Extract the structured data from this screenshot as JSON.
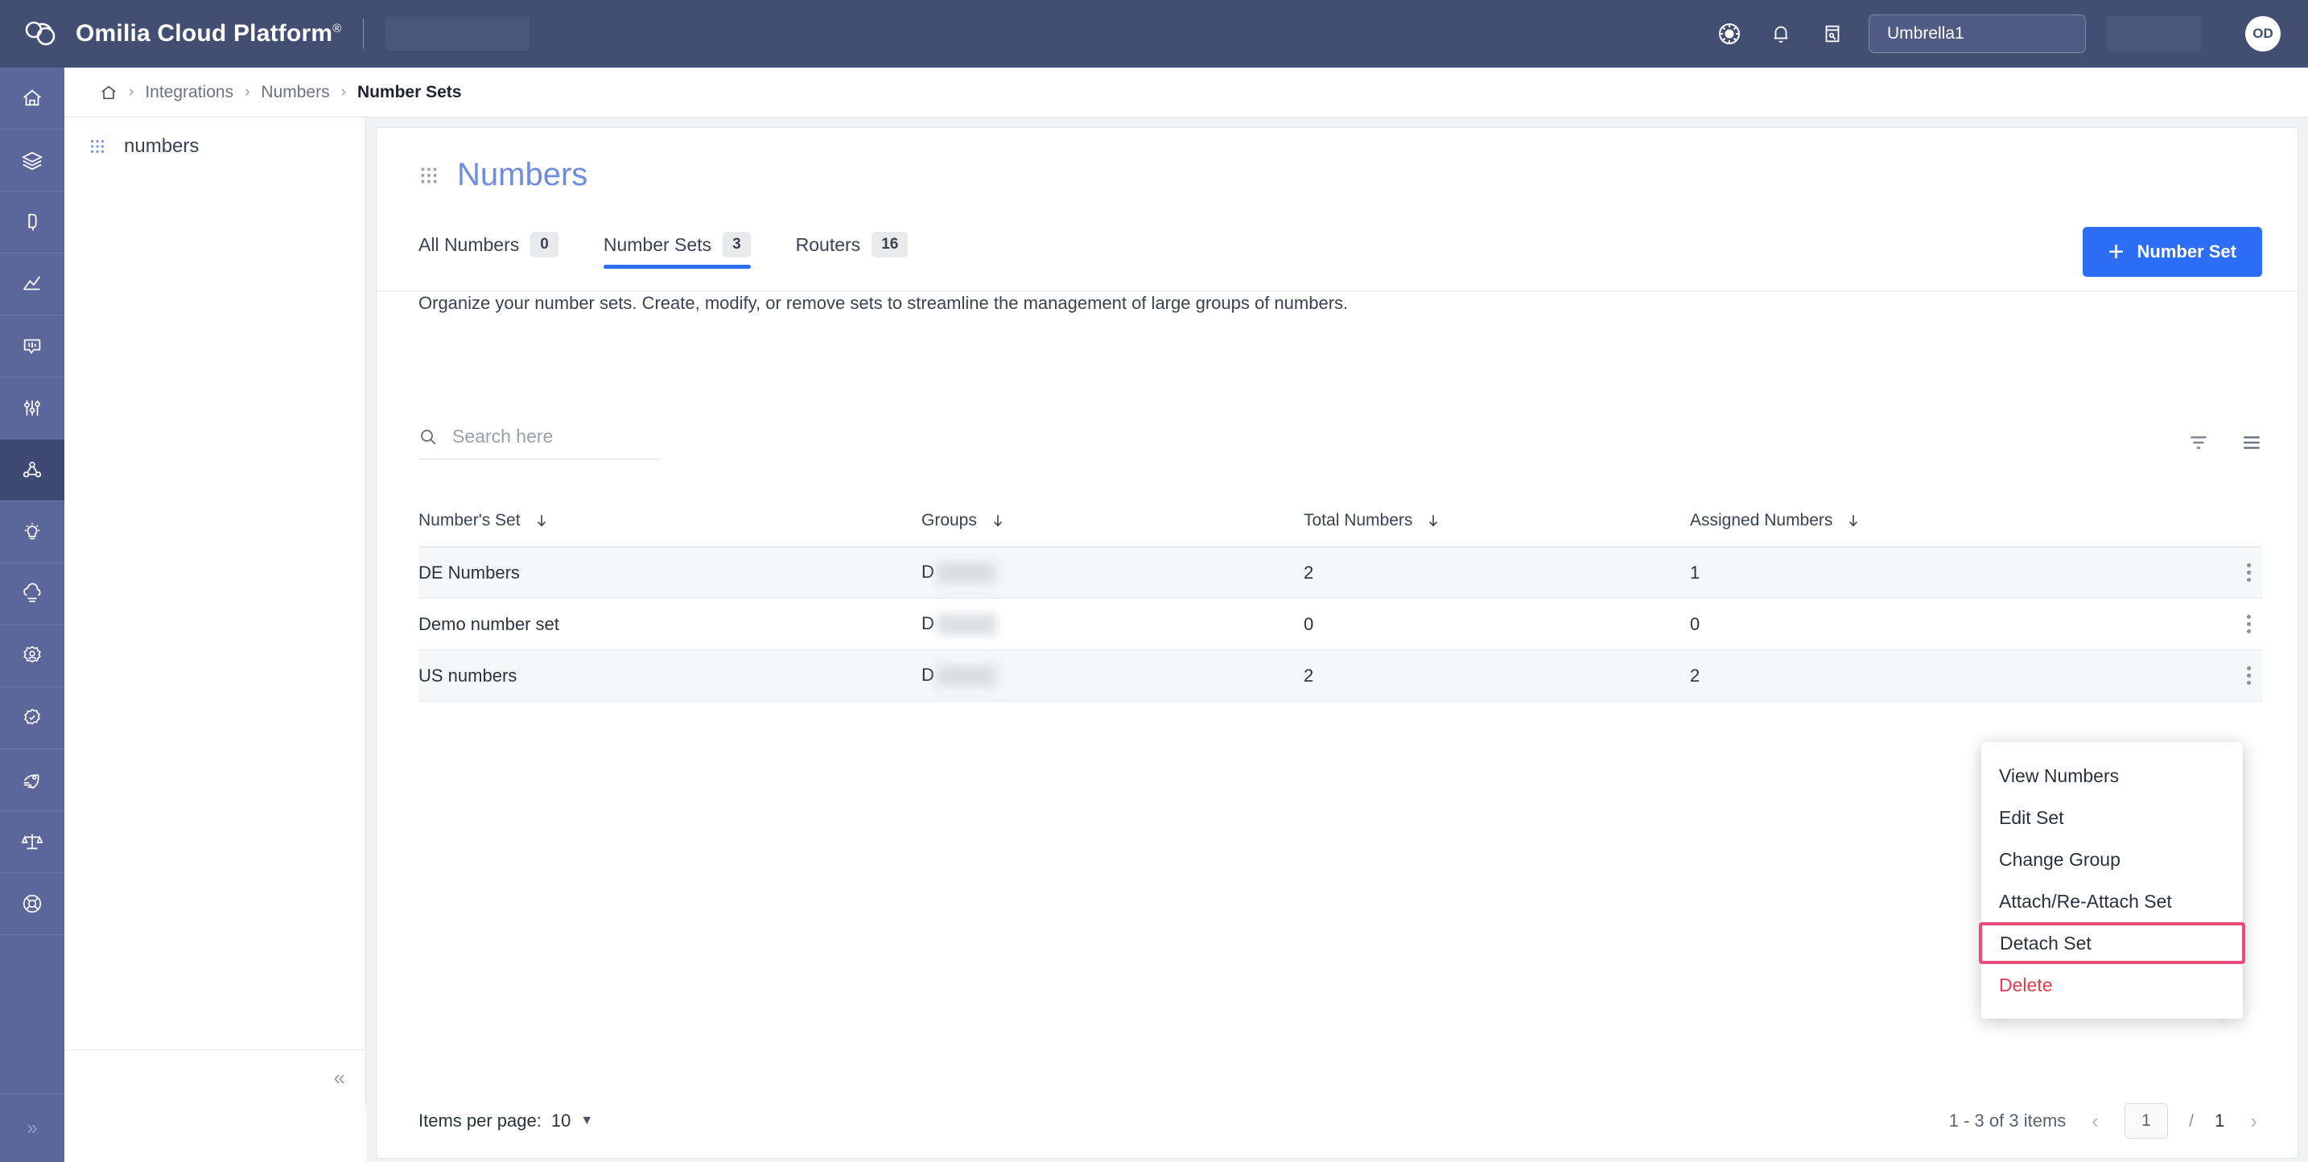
{
  "header": {
    "brand": "Omilia Cloud Platform",
    "brand_mark": "®",
    "logo_icon": "omilia-cloud-logo",
    "icons": [
      "accessibility-icon",
      "bell-icon",
      "note-edit-icon"
    ],
    "tenant": "Umbrella1",
    "avatar_initials": "OD"
  },
  "rail": {
    "items": [
      {
        "name": "home",
        "icon": "home-icon"
      },
      {
        "name": "layers",
        "icon": "layers-icon"
      },
      {
        "name": "voice",
        "icon": "microphone-icon"
      },
      {
        "name": "analytics",
        "icon": "analytics-chart-icon"
      },
      {
        "name": "conversations",
        "icon": "chat-bars-icon"
      },
      {
        "name": "tuning",
        "icon": "sliders-icon"
      },
      {
        "name": "integrations",
        "icon": "nodes-network-icon"
      },
      {
        "name": "insights",
        "icon": "lightbulb-icon"
      },
      {
        "name": "cloud",
        "icon": "cloud-lines-icon"
      },
      {
        "name": "accounts",
        "icon": "user-gear-icon"
      },
      {
        "name": "quality",
        "icon": "badge-check-icon"
      },
      {
        "name": "deployments",
        "icon": "rocket-icon"
      },
      {
        "name": "compliance",
        "icon": "scales-icon"
      },
      {
        "name": "support",
        "icon": "lifebuoy-icon"
      }
    ],
    "active_index": 6,
    "collapse_icon": "chevron-double-right-icon"
  },
  "breadcrumb": {
    "home_icon": "home-icon",
    "separator": "›",
    "items": [
      "Integrations",
      "Numbers",
      "Number Sets"
    ]
  },
  "subpanel": {
    "item_icon": "dot-grid-icon",
    "item_label": "numbers",
    "collapse_icon": "chevron-double-left-icon"
  },
  "page": {
    "title_icon": "dot-grid-icon",
    "title": "Numbers",
    "subtitle": "Organize your number sets. Create, modify, or remove sets to streamline the management of large groups of numbers.",
    "primary_button": {
      "label": "Number Set",
      "icon": "plus-icon"
    },
    "tabs": [
      {
        "label": "All Numbers",
        "badge": "0",
        "active": false
      },
      {
        "label": "Number Sets",
        "badge": "3",
        "active": true
      },
      {
        "label": "Routers",
        "badge": "16",
        "active": false
      }
    ]
  },
  "toolbar": {
    "search_placeholder": "Search here",
    "search_value": "",
    "search_icon": "search-icon",
    "filter_icon": "filter-icon",
    "list_view_icon": "list-icon"
  },
  "table": {
    "columns": [
      {
        "label": "Number's Set",
        "sort_icon": "sort-arrow-down-icon"
      },
      {
        "label": "Groups",
        "sort_icon": "sort-arrow-down-icon"
      },
      {
        "label": "Total Numbers",
        "sort_icon": "sort-arrow-down-icon"
      },
      {
        "label": "Assigned Numbers",
        "sort_icon": "sort-arrow-down-icon"
      }
    ],
    "rows": [
      {
        "set": "DE Numbers",
        "group_prefix": "D",
        "group_redacted": true,
        "total": "2",
        "assigned": "1",
        "menu_icon": "kebab-menu-icon"
      },
      {
        "set": "Demo number set",
        "group_prefix": "D",
        "group_redacted": true,
        "total": "0",
        "assigned": "0",
        "menu_icon": "kebab-menu-icon"
      },
      {
        "set": "US numbers",
        "group_prefix": "D",
        "group_redacted": true,
        "total": "2",
        "assigned": "2",
        "menu_icon": "kebab-menu-icon"
      }
    ]
  },
  "context_menu": {
    "items": [
      {
        "label": "View Numbers",
        "style": "normal"
      },
      {
        "label": "Edit Set",
        "style": "normal"
      },
      {
        "label": "Change Group",
        "style": "normal"
      },
      {
        "label": "Attach/Re-Attach Set",
        "style": "normal"
      },
      {
        "label": "Detach Set",
        "style": "highlight"
      },
      {
        "label": "Delete",
        "style": "danger"
      }
    ],
    "highlight_color": "#ec4c7d"
  },
  "pagination": {
    "items_per_page_label": "Items per page:",
    "items_per_page_value": "10",
    "caret_icon": "caret-down-icon",
    "range_text": "1 - 3 of 3 items",
    "prev_icon": "chevron-left-icon",
    "next_icon": "chevron-right-icon",
    "current_page": "1",
    "separator": "/",
    "total_pages": "1"
  },
  "colors": {
    "header_bg": "#434f72",
    "rail_bg": "#5b679a",
    "rail_active": "#3e4a71",
    "accent": "#2d6ef5",
    "title": "#6f8ce0",
    "danger": "#e23e4e",
    "highlight": "#ec4c7d"
  }
}
